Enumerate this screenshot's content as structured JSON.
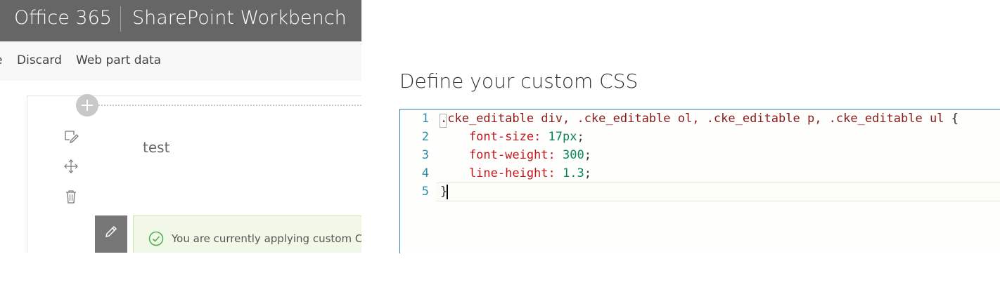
{
  "suitebar": {
    "brand": "Office 365",
    "title": "SharePoint Workbench"
  },
  "commandbar": {
    "partial": "e",
    "discard": "Discard",
    "web_part_data": "Web part data"
  },
  "canvas": {
    "add_icon": "plus-icon",
    "toolbar_icons": [
      "edit-icon",
      "move-icon",
      "delete-icon"
    ],
    "webpart_text": "test",
    "message": "You are currently applying custom CSS"
  },
  "panel": {
    "title": "Define your custom CSS",
    "editor": {
      "line_numbers": [
        "1",
        "2",
        "3",
        "4",
        "5"
      ],
      "lines": {
        "l1_selector": ".cke_editable div, .cke_editable ol, .cke_editable p, .cke_editable ul ",
        "l1_brace": "{",
        "l2_prop": "    font-size",
        "l2_colon": ": ",
        "l2_val": "17px",
        "l2_end": ";",
        "l3_prop": "    font-weight",
        "l3_colon": ": ",
        "l3_val": "300",
        "l3_end": ";",
        "l4_prop": "    line-height",
        "l4_colon": ": ",
        "l4_val": "1.3",
        "l4_end": ";",
        "l5_brace": "}"
      }
    }
  },
  "colors": {
    "suitebar_bg": "#666666",
    "accent_blue": "#2b7bb9",
    "selector": "#8a1a1a",
    "property": "#c5161d",
    "value": "#098658",
    "success_green": "#4caf50"
  }
}
